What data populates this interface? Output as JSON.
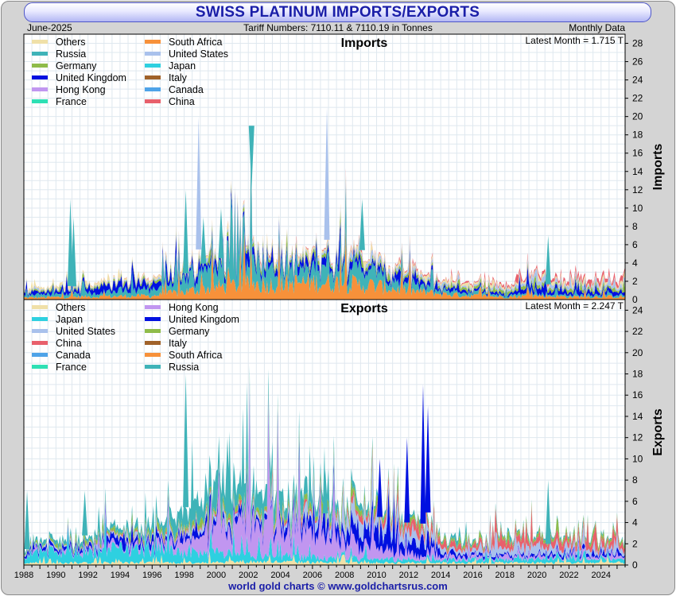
{
  "header": {
    "title": "SWISS PLATINUM IMPORTS/EXPORTS",
    "date": "June-2025",
    "subtitle": "Tariff Numbers: 7110.11 & 7110.19 in Tonnes",
    "frequency": "Monthly Data"
  },
  "footer": {
    "credit": "world gold charts © www.goldchartsrus.com"
  },
  "colors": {
    "Others": "#f0e0a8",
    "Russia": "#3fb3b8",
    "Germany": "#8fbc4a",
    "United Kingdom": "#0010e0",
    "Hong Kong": "#c196f0",
    "France": "#2ee0b4",
    "South Africa": "#f7913a",
    "United States": "#a9c1ec",
    "Japan": "#2ed0e0",
    "Italy": "#a0622a",
    "Canada": "#4ea3e8",
    "China": "#e8606c"
  },
  "chart_data": [
    {
      "type": "area",
      "stacked": true,
      "title": "Imports",
      "ylabel": "Imports",
      "annotation": "Latest Month = 1.715 T",
      "xlim": [
        1988,
        2025.5
      ],
      "ylim": [
        0,
        29
      ],
      "yticks": [
        0,
        2,
        4,
        6,
        8,
        10,
        12,
        14,
        16,
        18,
        20,
        22,
        24,
        26,
        28
      ],
      "xticks": [
        1988,
        1990,
        1992,
        1994,
        1996,
        1998,
        2000,
        2002,
        2004,
        2006,
        2008,
        2010,
        2012,
        2014,
        2016,
        2018,
        2020,
        2022,
        2024
      ],
      "legend": [
        "Others",
        "Russia",
        "Germany",
        "United Kingdom",
        "Hong Kong",
        "France",
        "South Africa",
        "United States",
        "Japan",
        "Italy",
        "Canada",
        "China"
      ],
      "series": [
        {
          "name": "South Africa",
          "values": [
            [
              1988,
              0.2
            ],
            [
              1992,
              0.3
            ],
            [
              1996,
              0.4
            ],
            [
              1998,
              0.8
            ],
            [
              2000,
              1.3
            ],
            [
              2002,
              1.6
            ],
            [
              2004,
              1.6
            ],
            [
              2006,
              1.8
            ],
            [
              2008,
              1.7
            ],
            [
              2010,
              1.4
            ],
            [
              2012,
              0.9
            ],
            [
              2014,
              0.6
            ],
            [
              2016,
              0.4
            ],
            [
              2018,
              0.3
            ],
            [
              2020,
              0.4
            ],
            [
              2022,
              0.3
            ],
            [
              2025,
              0.3
            ]
          ]
        },
        {
          "name": "Russia",
          "values": [
            [
              1988,
              0.2
            ],
            [
              1992,
              0.4
            ],
            [
              1996,
              0.7
            ],
            [
              1998,
              1.5
            ],
            [
              2000,
              2.0
            ],
            [
              2002,
              2.0
            ],
            [
              2004,
              1.8
            ],
            [
              2006,
              1.8
            ],
            [
              2008,
              1.6
            ],
            [
              2010,
              1.3
            ],
            [
              2012,
              0.8
            ],
            [
              2014,
              0.4
            ],
            [
              2016,
              0.3
            ],
            [
              2018,
              0.2
            ],
            [
              2020,
              0.2
            ],
            [
              2022,
              0.2
            ],
            [
              2025,
              0.2
            ]
          ]
        },
        {
          "name": "United Kingdom",
          "values": [
            [
              1988,
              0.2
            ],
            [
              1992,
              0.5
            ],
            [
              1994,
              0.8
            ],
            [
              1996,
              0.5
            ],
            [
              2000,
              0.5
            ],
            [
              2004,
              0.6
            ],
            [
              2006,
              0.7
            ],
            [
              2008,
              0.6
            ],
            [
              2010,
              0.5
            ],
            [
              2012,
              0.4
            ],
            [
              2014,
              0.3
            ],
            [
              2016,
              0.2
            ],
            [
              2018,
              0.2
            ],
            [
              2020,
              0.5
            ],
            [
              2022,
              0.3
            ],
            [
              2025,
              0.3
            ]
          ]
        },
        {
          "name": "Germany",
          "values": [
            [
              1988,
              0.1
            ],
            [
              1996,
              0.2
            ],
            [
              2000,
              0.3
            ],
            [
              2006,
              0.3
            ],
            [
              2010,
              0.3
            ],
            [
              2014,
              0.2
            ],
            [
              2020,
              0.3
            ],
            [
              2025,
              0.3
            ]
          ]
        },
        {
          "name": "United States",
          "values": [
            [
              1988,
              0.1
            ],
            [
              1996,
              0.1
            ],
            [
              2000,
              0.2
            ],
            [
              2006,
              0.2
            ],
            [
              2010,
              0.3
            ],
            [
              2014,
              0.2
            ],
            [
              2018,
              0.2
            ],
            [
              2020,
              0.5
            ],
            [
              2022,
              0.3
            ],
            [
              2025,
              0.3
            ]
          ]
        },
        {
          "name": "Others",
          "values": [
            [
              1988,
              0.1
            ],
            [
              1990,
              0.3
            ],
            [
              1992,
              0.2
            ],
            [
              2000,
              0.2
            ],
            [
              2010,
              0.2
            ],
            [
              2025,
              0.2
            ]
          ]
        },
        {
          "name": "China",
          "values": [
            [
              1988,
              0.0
            ],
            [
              2014,
              0.1
            ],
            [
              2018,
              0.2
            ],
            [
              2020,
              0.2
            ],
            [
              2022,
              0.3
            ],
            [
              2025,
              0.4
            ]
          ]
        }
      ],
      "spikes": [
        [
          1990.9,
          11
        ],
        [
          1991.1,
          9
        ],
        [
          1998.1,
          12
        ],
        [
          1998.9,
          20
        ],
        [
          1999.2,
          9
        ],
        [
          2000.3,
          10
        ],
        [
          2002.2,
          12
        ],
        [
          2006.9,
          21
        ],
        [
          2009.1,
          11
        ],
        [
          2020.7,
          7
        ]
      ]
    },
    {
      "type": "area",
      "stacked": true,
      "title": "Exports",
      "ylabel": "Exports",
      "annotation": "Latest Month = 2.247 T",
      "xlim": [
        1988,
        2025.5
      ],
      "ylim": [
        0,
        25
      ],
      "yticks": [
        0,
        2,
        4,
        6,
        8,
        10,
        12,
        14,
        16,
        18,
        20,
        22,
        24
      ],
      "xticks": [
        1988,
        1990,
        1992,
        1994,
        1996,
        1998,
        2000,
        2002,
        2004,
        2006,
        2008,
        2010,
        2012,
        2014,
        2016,
        2018,
        2020,
        2022,
        2024
      ],
      "legend": [
        "Others",
        "Japan",
        "United States",
        "China",
        "Canada",
        "France",
        "Hong Kong",
        "United Kingdom",
        "Germany",
        "Italy",
        "South Africa",
        "Russia"
      ],
      "series": [
        {
          "name": "Others",
          "values": [
            [
              1988,
              0.2
            ],
            [
              1996,
              0.2
            ],
            [
              2002,
              0.3
            ],
            [
              2010,
              0.2
            ],
            [
              2025,
              0.2
            ]
          ]
        },
        {
          "name": "Japan",
          "values": [
            [
              1988,
              0.7
            ],
            [
              1992,
              1.0
            ],
            [
              1996,
              1.2
            ],
            [
              2000,
              0.8
            ],
            [
              2004,
              0.5
            ],
            [
              2008,
              0.4
            ],
            [
              2012,
              0.3
            ],
            [
              2016,
              0.3
            ],
            [
              2020,
              0.3
            ],
            [
              2025,
              0.3
            ]
          ]
        },
        {
          "name": "Hong Kong",
          "values": [
            [
              1988,
              0.1
            ],
            [
              1996,
              0.3
            ],
            [
              1998,
              1.0
            ],
            [
              2000,
              2.0
            ],
            [
              2002,
              3.5
            ],
            [
              2004,
              3.0
            ],
            [
              2006,
              2.0
            ],
            [
              2008,
              1.5
            ],
            [
              2010,
              1.0
            ],
            [
              2012,
              0.5
            ],
            [
              2014,
              0.3
            ],
            [
              2018,
              0.2
            ],
            [
              2025,
              0.2
            ]
          ]
        },
        {
          "name": "United Kingdom",
          "values": [
            [
              1988,
              0.2
            ],
            [
              1996,
              0.4
            ],
            [
              2000,
              0.5
            ],
            [
              2004,
              0.6
            ],
            [
              2008,
              0.9
            ],
            [
              2010,
              1.6
            ],
            [
              2012,
              1.2
            ],
            [
              2013,
              1.3
            ],
            [
              2014,
              0.4
            ],
            [
              2016,
              0.2
            ],
            [
              2025,
              0.2
            ]
          ]
        },
        {
          "name": "United States",
          "values": [
            [
              1988,
              0.1
            ],
            [
              1996,
              0.2
            ],
            [
              2000,
              0.3
            ],
            [
              2004,
              0.4
            ],
            [
              2006,
              0.6
            ],
            [
              2008,
              0.8
            ],
            [
              2010,
              1.2
            ],
            [
              2012,
              0.9
            ],
            [
              2014,
              0.4
            ],
            [
              2016,
              0.3
            ],
            [
              2020,
              0.8
            ],
            [
              2022,
              0.4
            ],
            [
              2025,
              0.4
            ]
          ]
        },
        {
          "name": "China",
          "values": [
            [
              1988,
              0.0
            ],
            [
              2006,
              0.2
            ],
            [
              2010,
              0.4
            ],
            [
              2012,
              0.8
            ],
            [
              2014,
              0.5
            ],
            [
              2016,
              0.4
            ],
            [
              2018,
              0.6
            ],
            [
              2020,
              0.6
            ],
            [
              2022,
              0.6
            ],
            [
              2025,
              0.6
            ]
          ]
        },
        {
          "name": "Germany",
          "values": [
            [
              1988,
              0.1
            ],
            [
              1996,
              0.3
            ],
            [
              2000,
              0.4
            ],
            [
              2006,
              0.4
            ],
            [
              2010,
              0.3
            ],
            [
              2016,
              0.2
            ],
            [
              2025,
              0.3
            ]
          ]
        },
        {
          "name": "Russia",
          "values": [
            [
              1988,
              0.2
            ],
            [
              1992,
              0.4
            ],
            [
              1996,
              0.6
            ],
            [
              1998,
              1.6
            ],
            [
              2000,
              2.2
            ],
            [
              2002,
              1.8
            ],
            [
              2004,
              1.4
            ],
            [
              2006,
              1.0
            ],
            [
              2008,
              0.6
            ],
            [
              2010,
              0.4
            ],
            [
              2014,
              0.2
            ],
            [
              2025,
              0.1
            ]
          ]
        }
      ],
      "spikes": [
        [
          1988.2,
          7
        ],
        [
          1991.8,
          7
        ],
        [
          1998.1,
          18
        ],
        [
          2000.7,
          12
        ],
        [
          2006.8,
          9
        ],
        [
          2010.2,
          10
        ],
        [
          2011.9,
          12
        ],
        [
          2012.9,
          17
        ],
        [
          2013.2,
          15
        ],
        [
          2020.7,
          8
        ]
      ]
    }
  ]
}
